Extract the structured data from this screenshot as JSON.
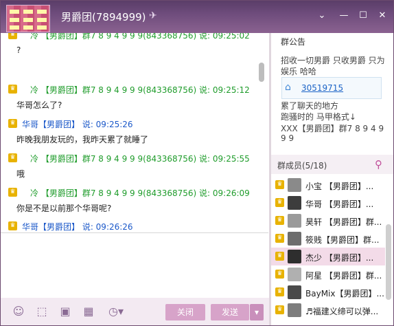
{
  "window": {
    "title": "男爵团(7894999)",
    "plane_icon": "plane-icon",
    "buttons": [
      "chevron-down-icon",
      "minimize-icon",
      "maximize-icon",
      "close-icon"
    ],
    "glyphs": {
      "chevron": "⌄",
      "minimize": "—",
      "maximize": "☐",
      "close": "✕"
    }
  },
  "chat": {
    "messages": [
      {
        "sender": "冷  【男爵团】群7 8 9 4 9 9 9(843368756) 说: 09:25:02",
        "text": "?"
      },
      {
        "sender": "冷  【男爵团】群7 8 9 4 9 9 9(843368756) 说: 09:25:12",
        "text": "华哥怎么了?"
      },
      {
        "sender": "华哥【男爵团】 说: 09:25:26",
        "text": "昨晚我朋友玩的，我昨天累了就睡了"
      },
      {
        "sender": "冷  【男爵团】群7 8 9 4 9 9 9(843368756) 说: 09:25:55",
        "text": "哦"
      },
      {
        "sender": "冷  【男爵团】群7 8 9 4 9 9 9(843368756) 说: 09:26:09",
        "text": "你是不是以前那个华哥呢?"
      },
      {
        "sender": "华哥【男爵团】 说: 09:26:26",
        "text": ""
      }
    ]
  },
  "toolbar": {
    "icons": [
      "emoji-icon",
      "screenshot-icon",
      "image-icon",
      "gallery-icon",
      "history-icon"
    ],
    "close_label": "关闭",
    "send_label": "发送",
    "send_arrow": "▾"
  },
  "notice": {
    "title": "群公告",
    "lines1": [
      "招收一切男爵  只收男爵  只为",
      "娱乐 哈哈"
    ],
    "qq": "30519715",
    "lines2": [
      "累了聊天的地方",
      "跑骚时的 马甲格式↓",
      "XXX【男爵团】群7 8 9 4 9",
      "9 9"
    ]
  },
  "members": {
    "title": "群成员(5/18)",
    "list": [
      {
        "name": "小宝 【男爵团】..."
      },
      {
        "name": "华哥 【男爵团】..."
      },
      {
        "name": "昊轩 【男爵团】群..."
      },
      {
        "name": "筱贱【男爵团】群..."
      },
      {
        "name": "杰少 【男爵团】..."
      },
      {
        "name": "阿星 【男爵团】群..."
      },
      {
        "name": "BayMix【男爵团】..."
      },
      {
        "name": "♬福建义缔可以弹..."
      }
    ]
  }
}
